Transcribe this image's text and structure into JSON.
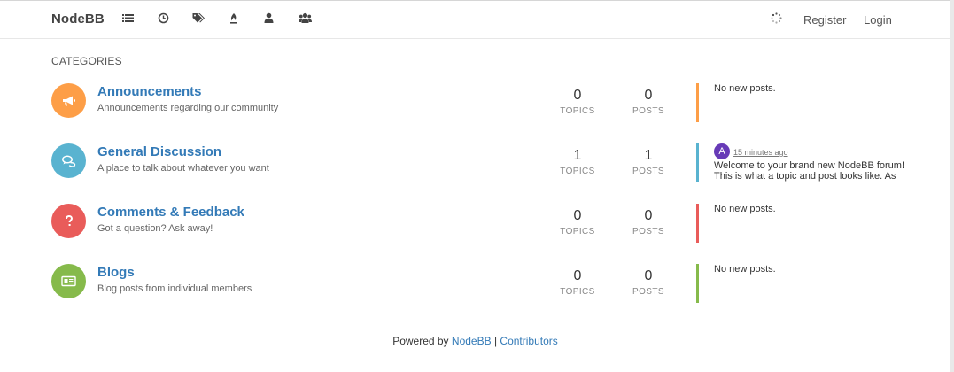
{
  "navbar": {
    "brand": "NodeBB",
    "icons": [
      "categories-icon",
      "recent-icon",
      "tags-icon",
      "popular-icon",
      "users-icon",
      "groups-icon"
    ],
    "status_icon": "loading-spinner-icon",
    "register_label": "Register",
    "login_label": "Login"
  },
  "section_title": "CATEGORIES",
  "categories": [
    {
      "name": "Announcements",
      "description": "Announcements regarding our community",
      "icon": "bullhorn-icon",
      "color": "#fd9e47",
      "topics": "0",
      "topics_label": "TOPICS",
      "posts": "0",
      "posts_label": "POSTS",
      "teaser": "No new posts."
    },
    {
      "name": "General Discussion",
      "description": "A place to talk about whatever you want",
      "icon": "comments-icon",
      "color": "#59b3d0",
      "topics": "1",
      "topics_label": "TOPICS",
      "posts": "1",
      "posts_label": "POSTS",
      "teaser_avatar": "A",
      "teaser_time": "15 minutes ago",
      "teaser_line1": "Welcome to your brand new NodeBB forum!",
      "teaser_line2": "This is what a topic and post looks like. As"
    },
    {
      "name": "Comments & Feedback",
      "description": "Got a question? Ask away!",
      "icon": "question-icon",
      "color": "#e95c5a",
      "topics": "0",
      "topics_label": "TOPICS",
      "posts": "0",
      "posts_label": "POSTS",
      "teaser": "No new posts."
    },
    {
      "name": "Blogs",
      "description": "Blog posts from individual members",
      "icon": "newspaper-icon",
      "color": "#86ba4b",
      "topics": "0",
      "topics_label": "TOPICS",
      "posts": "0",
      "posts_label": "POSTS",
      "teaser": "No new posts."
    }
  ],
  "footer": {
    "powered_by": "Powered by",
    "nodebb_link": "NodeBB",
    "separator": "|",
    "contributors_link": "Contributors"
  }
}
